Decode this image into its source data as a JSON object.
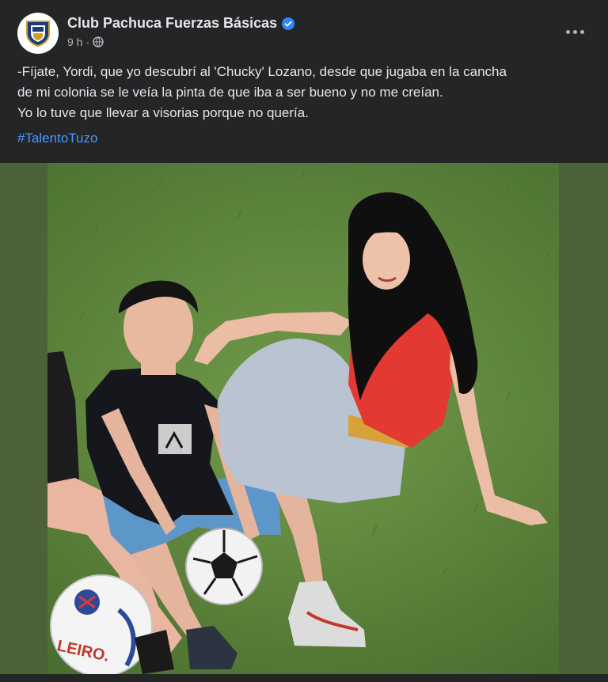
{
  "post": {
    "author": "Club Pachuca Fuerzas Básicas",
    "time": "9 h",
    "separator": "·",
    "avatar_icon": "club-crest-icon",
    "verified_icon": "verified-badge-icon",
    "privacy_icon": "globe-icon",
    "more_icon": "more-options-icon",
    "text_lines": [
      "-Fíjate, Yordi, que yo descubrí al 'Chucky' Lozano, desde que jugaba en la cancha",
      "de mi colonia se le veía la pinta de que iba a ser bueno y no me creían.",
      "Yo lo tuve que llevar a visorias porque no quería."
    ],
    "hashtag": "#TalentoTuzo",
    "photo_text": "LEIRO.",
    "colors": {
      "background": "#242526",
      "text": "#e4e6eb",
      "secondary": "#b0b3b8",
      "link": "#4599ff",
      "verified": "#2d88ff",
      "photo_border": "#4b6138"
    }
  }
}
